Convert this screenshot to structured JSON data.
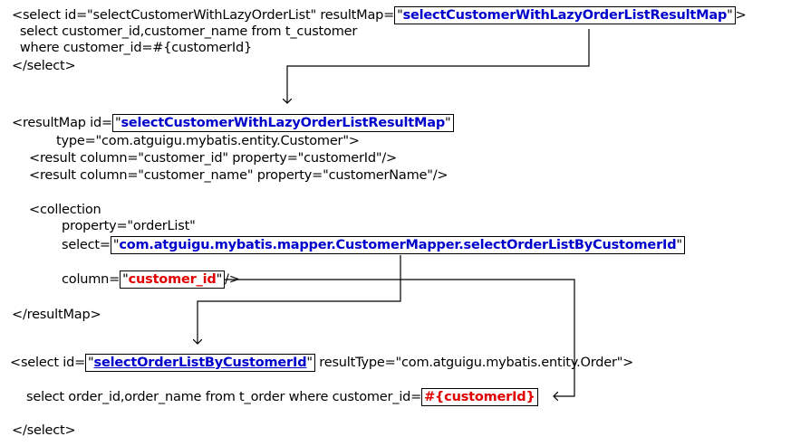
{
  "lines": {
    "l1a": "<select id=\"selectCustomerWithLazyOrderList\" resultMap=",
    "l1q1": "\"",
    "l1ref": "selectCustomerWithLazyOrderListResultMap",
    "l1q2": "\"",
    "l1b": ">",
    "l2": "  select customer_id,customer_name from t_customer",
    "l3": "  where customer_id=#{customerId}",
    "l4": "</select>",
    "l5a": "<resultMap id=",
    "l5q1": "\"",
    "l5ref": "selectCustomerWithLazyOrderListResultMap",
    "l5q2": "\"",
    "l6": "type=\"com.atguigu.mybatis.entity.Customer\">",
    "l7": "<result column=\"customer_id\" property=\"customerId\"/>",
    "l8": "<result column=\"customer_name\" property=\"customerName\"/>",
    "l9": "<collection",
    "l10": "property=\"orderList\"",
    "l11a": "select=",
    "l11q1": "\"",
    "l11ref": "com.atguigu.mybatis.mapper.CustomerMapper.selectOrderListByCustomerId",
    "l11q2": "\"",
    "l12a": "column=",
    "l12q1": "\"",
    "l12ref": "customer_id",
    "l12q2": "\"",
    "l12b": "/>",
    "l13": "</resultMap>",
    "l14a": "<select id=",
    "l14q1": "\"",
    "l14ref": "selectOrderListByCustomerId",
    "l14q2": "\"",
    "l14b": " resultType=\"com.atguigu.mybatis.entity.Order\">",
    "l15a": "select order_id,order_name from t_order where customer_id=",
    "l15ref": "#{customerId}",
    "l16": "</select>"
  },
  "colors": {
    "highlight_blue": "#0000cc",
    "highlight_red": "#e00000",
    "text": "#000000",
    "arrow": "#000000"
  }
}
